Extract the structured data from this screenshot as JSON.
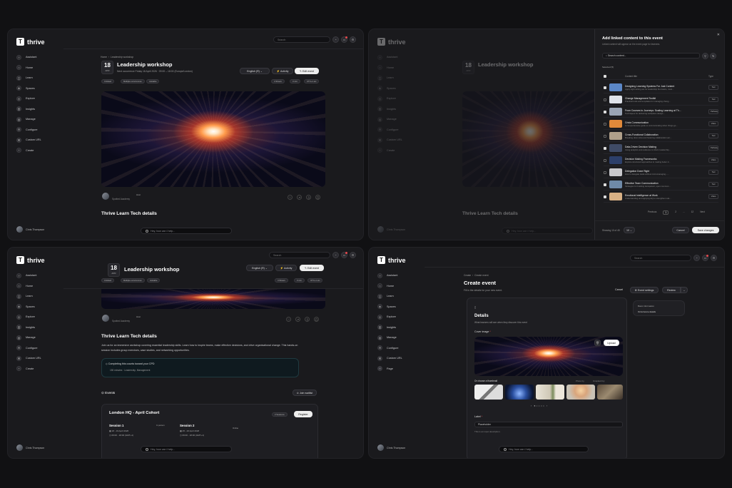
{
  "app": {
    "name": "thrive",
    "logo_letter": "T"
  },
  "nav": [
    "Assistant",
    "Home",
    "Learn",
    "Spaces",
    "Explore",
    "Insights",
    "Manage",
    "Configure",
    "Custom URL",
    "Create"
  ],
  "nav_p4": [
    "Assistant",
    "Home",
    "Learn",
    "Spaces",
    "Explore",
    "Insights",
    "Manage",
    "Configure",
    "Custom URL",
    "Page"
  ],
  "user": "Chris Thompson",
  "search_placeholder": "Search",
  "ask_placeholder": "Hey, how can I help...",
  "event": {
    "breadcrumb_home": "Home",
    "breadcrumb_current": "Leadership workshop",
    "day": "18",
    "month": "APR",
    "title": "Leadership workshop",
    "next_occurrence": "Next occurrence Friday 18 April 2026 · 09:00 – 18:00 (Europe/London)",
    "lang": "English (R)",
    "activity_label": "Activity",
    "edit_label": "Edit event",
    "tags": [
      "Unlisted",
      "Multiple occurrences",
      "Joinable"
    ],
    "meta": [
      "4 Shows",
      "3 min",
      "UTC+1 etc"
    ],
    "host_label": "Spotted Academy",
    "host_badge": "Host",
    "section_title": "Thrive Learn Tech details",
    "description": "Join us for an immersive workshop covering essential leadership skills. Learn how to inspire teams, make effective decisions, and drive organisational change. This hands-on session includes group exercises, case studies, and networking opportunities.",
    "course_title": "Completing this counts toward your CPD",
    "course_sub": "150 minutes · Leadership, Management",
    "events_label": "Events",
    "join_waitlist": "Join waitlist",
    "cohort_title": "London HQ - April Cohort",
    "cohort_badge": "2 Sessions",
    "register_label": "Register",
    "session1": "Session 1",
    "session1_date": "18 - 19 April 2026",
    "session1_time": "09:00 - 18:00 (GMT+1)",
    "session1_tag": "In person",
    "session2": "Session 2",
    "session2_date": "25 - 26 April 2026",
    "session2_time": "09:00 - 18:00 (GMT+1)",
    "session2_tag": "Online"
  },
  "modal": {
    "title": "Add linked content to this event",
    "subtitle": "Linked content will appear on the event page for learners.",
    "search": "Search content...",
    "selected": "Selected (5)",
    "col_title": "Content title",
    "col_type": "Type",
    "rows": [
      {
        "a": "Designing Learning Systems For Just Content",
        "b": "Apply sight writing are for leadership the basics, must...",
        "type": "Tool",
        "on": true,
        "c": "#5b87c7"
      },
      {
        "a": "Change Management Toolkit",
        "b": "Practical tools and templates for managing chang...",
        "type": "Tool",
        "on": false,
        "c": "#dfe3ea"
      },
      {
        "a": "From Courses to Journeys: Scaling Learning at Th...",
        "b": "Techniques for delivering workplace design...",
        "type": "Pathway",
        "on": true,
        "c": "#9aa4b4"
      },
      {
        "a": "Crisis Communication",
        "b": "A comprehensive guide to communicating when things go...",
        "type": "Video",
        "on": false,
        "c": "#e0893a"
      },
      {
        "a": "Cross-Functional Collaboration",
        "b": "Breaking down silos and fostering collaboration acr...",
        "type": "Tool",
        "on": false,
        "c": "#b0a08a"
      },
      {
        "a": "Data-Driven Decision Making",
        "b": "Using analytics and evidence to inform leadership...",
        "type": "Pathway",
        "on": true,
        "c": "#3f4b66"
      },
      {
        "a": "Decision Making Frameworks",
        "b": "Explore structured approaches to making better d...",
        "type": "Video",
        "on": false,
        "c": "#2c3f6a"
      },
      {
        "a": "Delegation Done Right",
        "b": "How to delegate tasks without micromanaging - ...",
        "type": "Tool",
        "on": false,
        "c": "#c8c8cc"
      },
      {
        "a": "Effective Team Communication",
        "b": "Strategies for building transparent, open commun...",
        "type": "Tool",
        "on": true,
        "c": "#6f8aa8"
      },
      {
        "a": "Emotional Intelligence at Work",
        "b": "Understanding and applying EQ to strengthen rela...",
        "type": "Video",
        "on": true,
        "c": "#d9b185"
      }
    ],
    "pager": [
      "Previous",
      "1",
      "2",
      "...",
      "12",
      "Next"
    ],
    "showing": "Showing 10 of 45",
    "per_page": "10",
    "cancel": "Cancel",
    "save": "Save changes"
  },
  "create": {
    "crumb1": "Create",
    "crumb2": "Create event",
    "title": "Create event",
    "subtitle": "Fill in the details for your new event.",
    "cancel": "Cancel",
    "settings": "Event settings",
    "review": "Review",
    "side": [
      "Basic information",
      "Occurrence details"
    ],
    "details_title": "Details",
    "details_sub": "What learners will see when they discover this event",
    "cover_label": "Cover image",
    "upload": "Upload",
    "choose": "Or choose a thumbnail",
    "photo_by": "Photo by",
    "unsplash": "Unsplash by",
    "label_label": "Label",
    "label_value": "Placeholder",
    "hint": "This is an input description."
  }
}
